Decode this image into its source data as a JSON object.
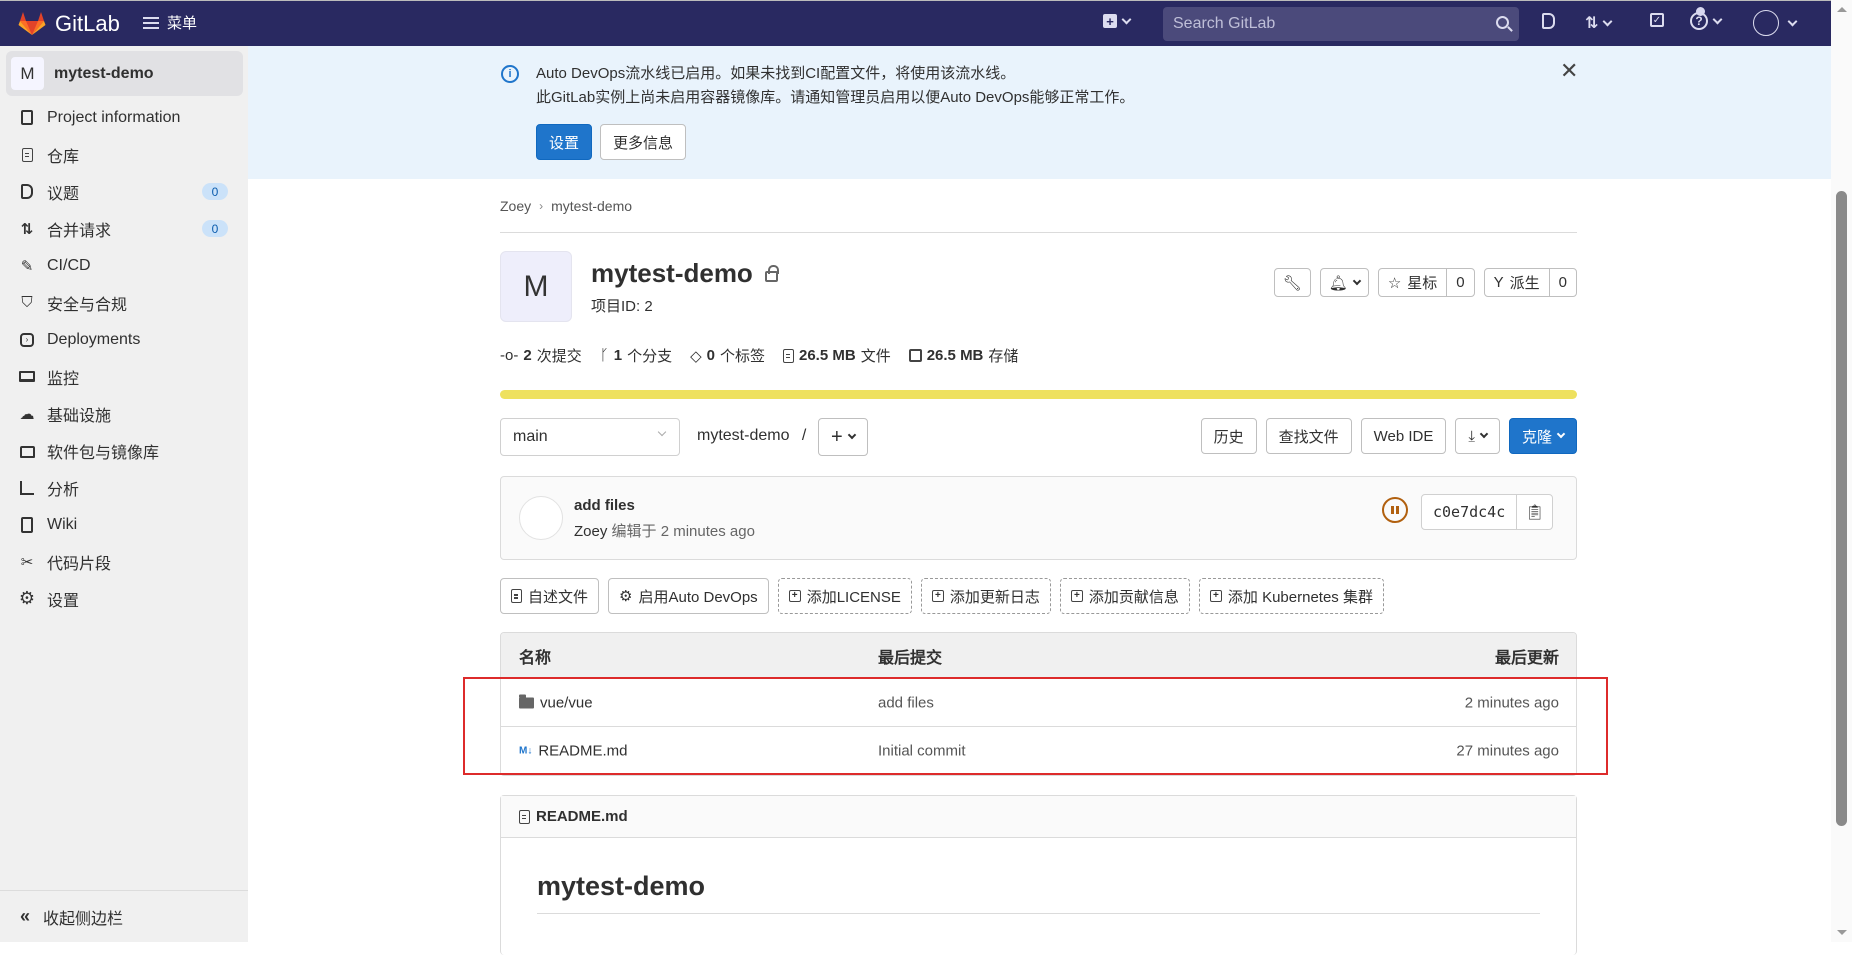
{
  "header": {
    "brand": "GitLab",
    "menu_label": "菜单",
    "search_placeholder": "Search GitLab",
    "colors": {
      "bar": "#292961",
      "search": "#4b4a7b"
    }
  },
  "sidebar": {
    "project_avatar": "M",
    "project_name": "mytest-demo",
    "items": [
      {
        "label": "Project information",
        "icon": "project-info-icon"
      },
      {
        "label": "仓库",
        "icon": "repository-icon"
      },
      {
        "label": "议题",
        "icon": "issues-icon",
        "badge": "0"
      },
      {
        "label": "合并请求",
        "icon": "merge-request-icon",
        "badge": "0"
      },
      {
        "label": "CI/CD",
        "icon": "rocket-icon"
      },
      {
        "label": "安全与合规",
        "icon": "shield-icon"
      },
      {
        "label": "Deployments",
        "icon": "deployments-icon"
      },
      {
        "label": "监控",
        "icon": "monitor-icon"
      },
      {
        "label": "基础设施",
        "icon": "cloud-gear-icon"
      },
      {
        "label": "软件包与镜像库",
        "icon": "package-icon"
      },
      {
        "label": "分析",
        "icon": "chart-icon"
      },
      {
        "label": "Wiki",
        "icon": "book-icon"
      },
      {
        "label": "代码片段",
        "icon": "snippet-icon"
      },
      {
        "label": "设置",
        "icon": "gear-icon"
      }
    ],
    "collapse_label": "收起侧边栏"
  },
  "banner": {
    "line1": "Auto DevOps流水线已启用。如果未找到CI配置文件，将使用该流水线。",
    "line2": "此GitLab实例上尚未启用容器镜像库。请通知管理员启用以便Auto DevOps能够正常工作。",
    "primary_button": "设置",
    "secondary_button": "更多信息"
  },
  "breadcrumb": [
    "Zoey",
    "mytest-demo"
  ],
  "project": {
    "avatar": "M",
    "title": "mytest-demo",
    "id_label": "项目ID: 2",
    "star_label": "星标",
    "star_count": "0",
    "fork_label": "派生",
    "fork_count": "0"
  },
  "stats": [
    {
      "value": "2",
      "label": "次提交",
      "icon": "commit-icon"
    },
    {
      "value": "1",
      "label": "个分支",
      "icon": "branch-icon"
    },
    {
      "value": "0",
      "label": "个标签",
      "icon": "tag-icon"
    },
    {
      "value": "26.5 MB",
      "label": "文件",
      "icon": "file-icon"
    },
    {
      "value": "26.5 MB",
      "label": "存储",
      "icon": "storage-icon"
    }
  ],
  "language_bar_color": "#eee15f",
  "branch": {
    "selected": "main",
    "path": "mytest-demo",
    "path_sep": "/",
    "history": "历史",
    "find_file": "查找文件",
    "web_ide": "Web IDE",
    "clone": "克隆"
  },
  "last_commit": {
    "title": "add files",
    "author": "Zoey",
    "action": "编辑于",
    "time": "2 minutes ago",
    "sha": "c0e7dc4c",
    "pipeline_status": "paused"
  },
  "quick_actions": [
    {
      "label": "自述文件",
      "style": "solid",
      "icon": "file-icon"
    },
    {
      "label": "启用Auto DevOps",
      "style": "solid",
      "icon": "gear-icon"
    },
    {
      "label": "添加LICENSE",
      "style": "dashed",
      "icon": "plus-square-icon"
    },
    {
      "label": "添加更新日志",
      "style": "dashed",
      "icon": "plus-square-icon"
    },
    {
      "label": "添加贡献信息",
      "style": "dashed",
      "icon": "plus-square-icon"
    },
    {
      "label": "添加 Kubernetes 集群",
      "style": "dashed",
      "icon": "plus-square-icon"
    }
  ],
  "file_table": {
    "headers": [
      "名称",
      "最后提交",
      "最后更新"
    ],
    "rows": [
      {
        "name": "vue/vue",
        "type": "folder",
        "commit": "add files",
        "updated": "2 minutes ago"
      },
      {
        "name": "README.md",
        "type": "markdown",
        "commit": "Initial commit",
        "updated": "27 minutes ago"
      }
    ]
  },
  "readme": {
    "filename": "README.md",
    "heading": "mytest-demo"
  },
  "highlight_color": "#dd2b2b"
}
